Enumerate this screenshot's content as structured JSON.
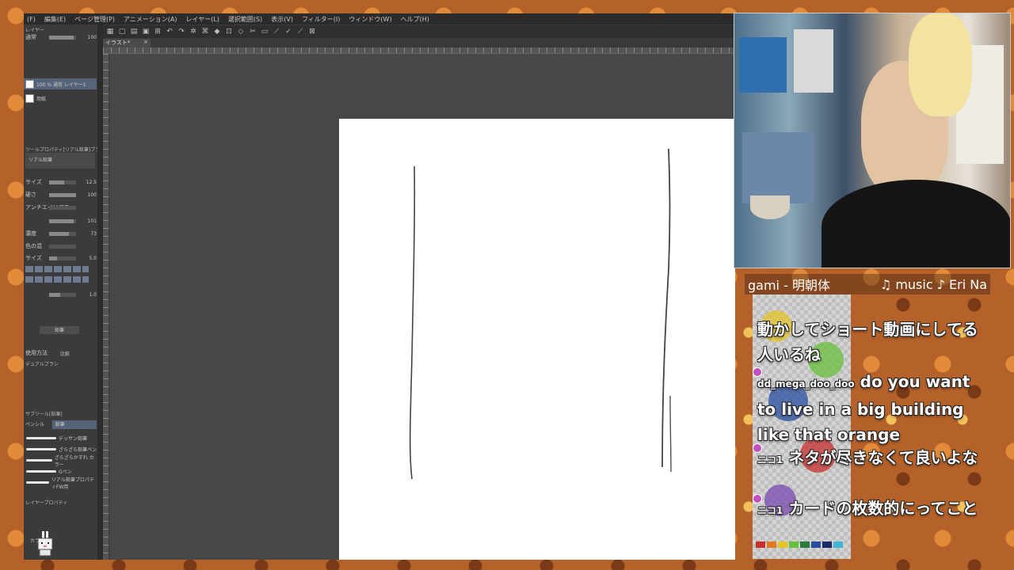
{
  "app": {
    "menu": [
      "(F)",
      "編集(E)",
      "ページ管理(P)",
      "アニメーション(A)",
      "レイヤー(L)",
      "選択範囲(S)",
      "表示(V)",
      "フィルター(I)",
      "ウィンドウ(W)",
      "ヘルプ(H)"
    ],
    "toolbar_icons": [
      "▦",
      "▢",
      "▤",
      "▣",
      "⊞",
      "↶",
      "↷",
      "✲",
      "⌘",
      "◆",
      "⊡",
      "◇",
      "✂",
      "▭",
      "⟋",
      "✓",
      "⟋",
      "⊠"
    ],
    "doc_tab": {
      "label": "イラスト*",
      "close": "×"
    }
  },
  "left_panel": {
    "layer_header": "レイヤー",
    "blend_mode": "通常",
    "opacity": "100",
    "layers": [
      {
        "name": "100 % 通常 レイヤー1",
        "selected": true
      },
      {
        "name": "用紙",
        "selected": false
      }
    ],
    "tool_property_title": "ツールプロパティ[リアル鉛筆]ブラシ",
    "brush_name": "リアル鉛筆",
    "properties": [
      {
        "label": "サイズ",
        "value": "12.5",
        "level": 0.55
      },
      {
        "label": "硬さ",
        "value": "100",
        "level": 1.0
      },
      {
        "label": "アンチエイリアス",
        "value": "",
        "level": 0.0
      },
      {
        "label": "",
        "value": "101",
        "level": 0.9
      },
      {
        "label": "濃度",
        "value": "73",
        "level": 0.73
      },
      {
        "label": "色の混",
        "value": "",
        "level": 0.0
      },
      {
        "label": "サイズ",
        "value": "5.0",
        "level": 0.3
      },
      {
        "label": "",
        "value": "1.0",
        "level": 0.4
      }
    ],
    "texture_label": "鉛筆",
    "method_label": "使用方法",
    "method_value": "比較",
    "dual_brush": "デュアルブラシ",
    "sub_tool_header": "サブツール[鉛筆]",
    "sub_tool_tabs": [
      "ペンシル",
      "鉛筆"
    ],
    "brushes": [
      "デッサン鉛筆",
      "ざらざら鉛筆ペン",
      "ざらざらかすれ カラー",
      "Gペン",
      "リアル鉛筆プロパティFW用"
    ],
    "layer_property": "レイヤープロパティ",
    "color_label": "カラー"
  },
  "webcam": {},
  "ticker": {
    "left": "gami - 明朝体",
    "right": "♫ music ♪ Eri Na"
  },
  "chat": [
    {
      "user": "",
      "text": "動かしてショート動画にしてる人いるね",
      "badge": false
    },
    {
      "user": "dd_mega_doo_doo",
      "text": "do you want to live in a big building like that orange",
      "badge": true
    },
    {
      "user": "ニコ1",
      "text": "ネタが尽きなくて良いよな",
      "badge": true
    },
    {
      "user": "ニコ1",
      "text": "カードの枚数的にってこと",
      "badge": true
    }
  ],
  "colors": {
    "accent_layer": "#56647a",
    "chat_badge": "#c44fbf",
    "palette": [
      "#c8302e",
      "#e07a22",
      "#e6c42a",
      "#6bbf3c",
      "#2d7d3a",
      "#2a4ea0",
      "#1b2a6b",
      "#43b7d1"
    ]
  }
}
